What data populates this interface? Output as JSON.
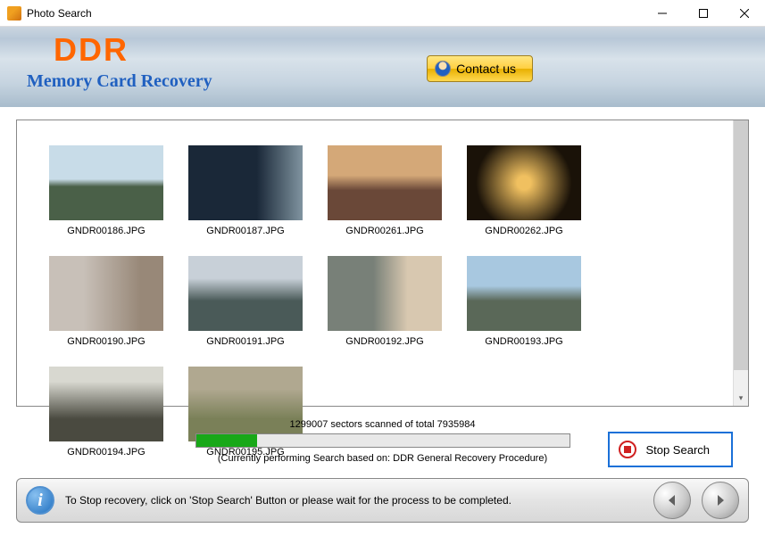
{
  "window": {
    "title": "Photo Search"
  },
  "header": {
    "logo_text": "DDR",
    "subtitle": "Memory Card Recovery",
    "contact_label": "Contact us"
  },
  "results": {
    "items": [
      {
        "filename": "GNDR00186.JPG"
      },
      {
        "filename": "GNDR00187.JPG"
      },
      {
        "filename": "GNDR00261.JPG"
      },
      {
        "filename": "GNDR00262.JPG"
      },
      {
        "filename": "GNDR00190.JPG"
      },
      {
        "filename": "GNDR00191.JPG"
      },
      {
        "filename": "GNDR00192.JPG"
      },
      {
        "filename": "GNDR00193.JPG"
      },
      {
        "filename": "GNDR00194.JPG"
      },
      {
        "filename": "GNDR00195.JPG"
      }
    ]
  },
  "progress": {
    "sectors_scanned": 1299007,
    "sectors_total": 7935984,
    "status_text": "1299007 sectors scanned of total 7935984",
    "method_text": "(Currently performing Search based on:  DDR General Recovery Procedure)",
    "stop_label": "Stop Search"
  },
  "footer": {
    "hint": "To Stop recovery, click on 'Stop Search' Button or please wait for the process to be completed."
  }
}
